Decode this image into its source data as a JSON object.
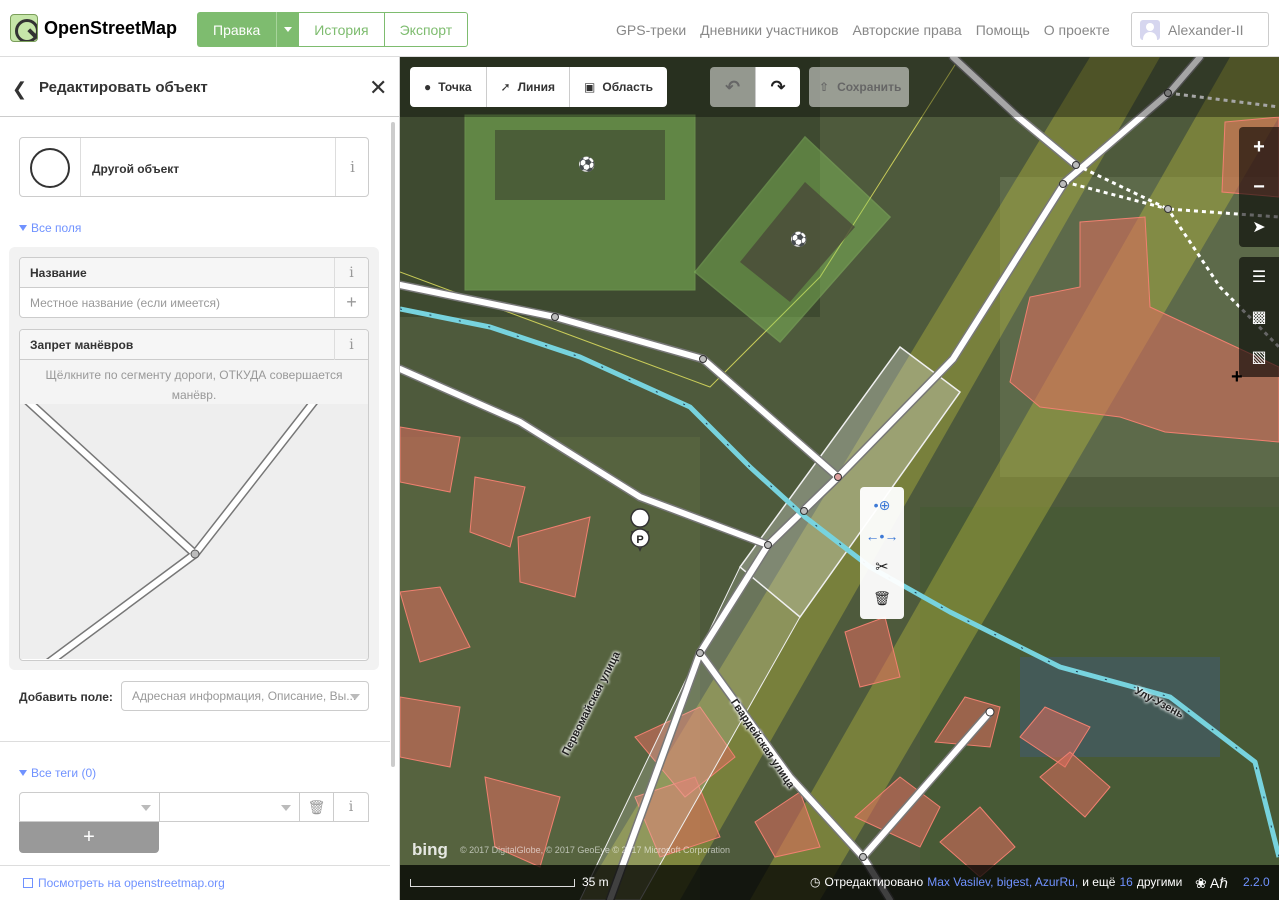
{
  "app": {
    "title": "OpenStreetMap"
  },
  "header": {
    "edit_label": "Правка",
    "history_label": "История",
    "export_label": "Экспорт",
    "nav": [
      "GPS-треки",
      "Дневники участников",
      "Авторские права",
      "Помощь",
      "О проекте"
    ],
    "user": "Alexander-II"
  },
  "sidebar": {
    "title": "Редактировать объект",
    "preset_label": "Другой объект",
    "all_fields_label": "Все поля",
    "name_field": {
      "label": "Название",
      "placeholder": "Местное название (если имеется)"
    },
    "turn_field": {
      "label": "Запрет манёвров",
      "hint": "Щёлкните по сегменту дороги, ОТКУДА совершается манёвр."
    },
    "add_field_label": "Добавить поле:",
    "add_field_placeholder": "Адресная информация, Описание, Вы...",
    "all_tags_label": "Все теги (0)",
    "view_link": "Посмотреть на openstreetmap.org"
  },
  "map": {
    "modes": [
      "Точка",
      "Линия",
      "Область"
    ],
    "save_label": "Сохранить",
    "road_labels": [
      "Первомайская улица",
      "Гвардейская улица",
      "Улу-Узень"
    ],
    "scale_label": "35 m",
    "attribution_prefix": "Отредактировано",
    "attribution_users": "Max Vasilev, bigest, AzurRu,",
    "attribution_suffix_before": "и ещё",
    "attribution_count": "16",
    "attribution_suffix_after": "другими",
    "version": "2.2.0",
    "bing_label": "bing",
    "imagery_copyright": "© 2017 DigitalGlobe, © 2017 GeoEye © 2017 Microsoft Corporation"
  },
  "colors": {
    "accent_green": "#7ebc6f",
    "link_blue": "#7092ff",
    "waterway": "#77d3de",
    "building": "#e06e5f",
    "landuse_green": "#8cd05f",
    "highlight_yellow": "#c8c83c"
  },
  "icons": [
    "logo-icon",
    "caret-down-icon",
    "user-avatar-icon",
    "back-icon",
    "close-icon",
    "info-icon",
    "plus-icon",
    "trash-icon",
    "point-icon",
    "line-icon",
    "area-icon",
    "undo-icon",
    "redo-icon",
    "save-icon",
    "zoom-in-icon",
    "zoom-out-icon",
    "geolocate-icon",
    "layers-icon",
    "data-layers-icon",
    "note-icon",
    "continue-icon",
    "disconnect-icon",
    "split-icon",
    "delete-icon",
    "external-link-icon",
    "bug-icon",
    "translate-icon",
    "parking-icon"
  ]
}
